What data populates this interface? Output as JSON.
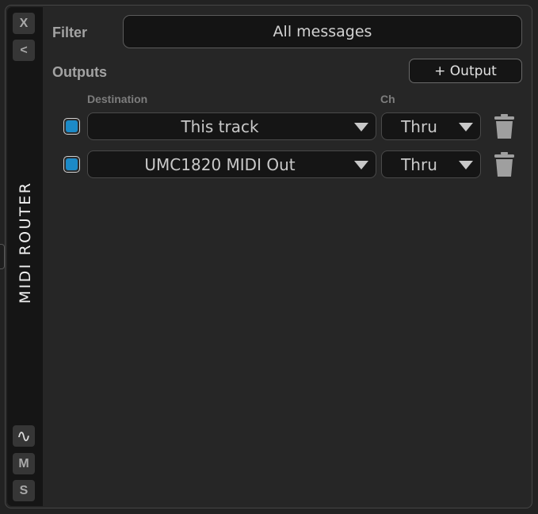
{
  "sidebar": {
    "close_label": "X",
    "collapse_label": "<",
    "title": "MIDI ROUTER",
    "wave_icon": "∿",
    "mute_label": "M",
    "solo_label": "S"
  },
  "filter": {
    "label": "Filter",
    "value": "All messages"
  },
  "outputs": {
    "label": "Outputs",
    "add_button_label": "+ Output",
    "col_destination": "Destination",
    "col_channel": "Ch",
    "rows": [
      {
        "enabled": true,
        "destination": "This track",
        "channel": "Thru"
      },
      {
        "enabled": true,
        "destination": "UMC1820 MIDI Out",
        "channel": "Thru"
      }
    ]
  },
  "colors": {
    "toggle_accent": "#1c8ac7",
    "background": "#262626"
  }
}
